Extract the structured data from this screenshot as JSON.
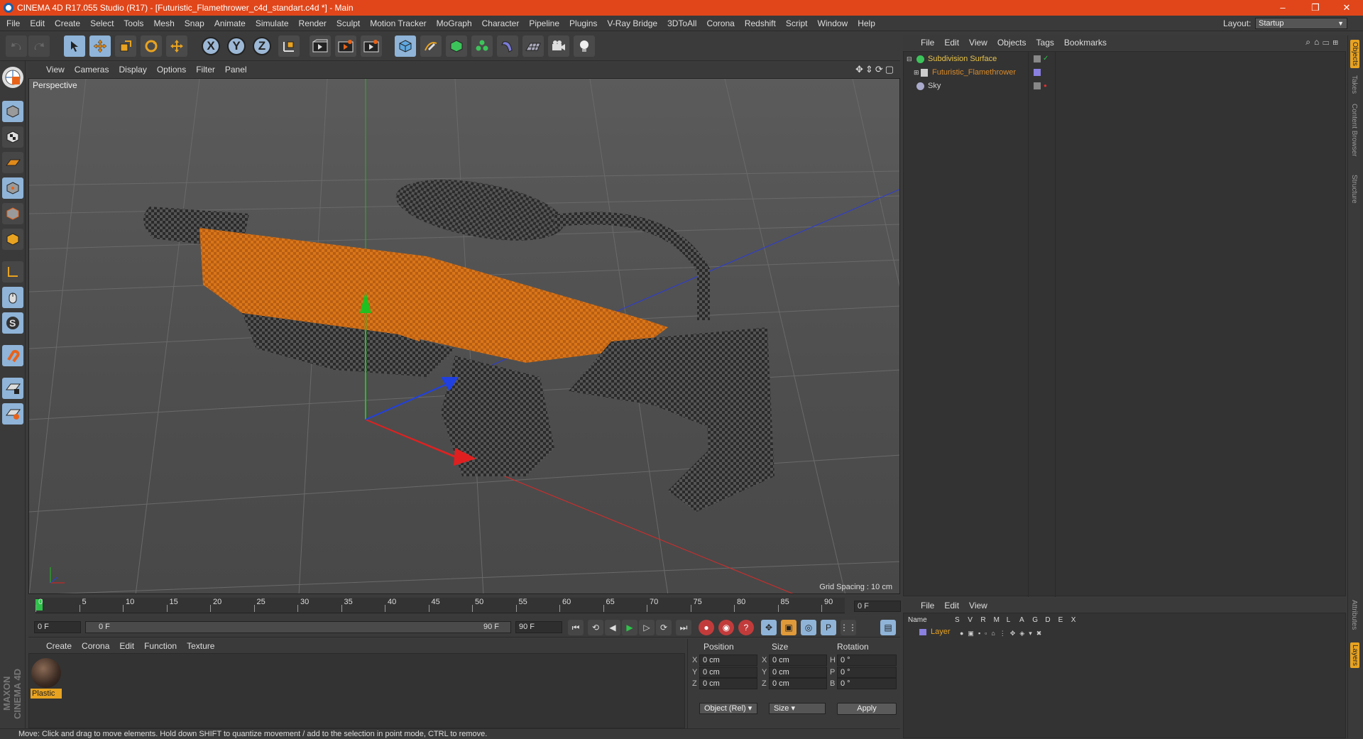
{
  "window": {
    "title": "CINEMA 4D R17.055 Studio (R17) - [Futuristic_Flamethrower_c4d_standart.c4d *] - Main",
    "minimize": "–",
    "restore": "❐",
    "close": "✕"
  },
  "menubar": {
    "items": [
      "File",
      "Edit",
      "Create",
      "Select",
      "Tools",
      "Mesh",
      "Snap",
      "Animate",
      "Simulate",
      "Render",
      "Sculpt",
      "Motion Tracker",
      "MoGraph",
      "Character",
      "Pipeline",
      "Plugins",
      "V-Ray Bridge",
      "3DToAll",
      "Corona",
      "Redshift",
      "Script",
      "Window",
      "Help"
    ],
    "layout_label": "Layout:",
    "layout_value": "Startup"
  },
  "toolbar": {
    "icons": [
      "undo-icon",
      "redo-icon",
      "live-selection-icon",
      "move-icon",
      "scale-icon",
      "rotate-icon",
      "last-tool-icon",
      "x-axis-icon",
      "y-axis-icon",
      "z-axis-icon",
      "world-coord-icon",
      "render-view-icon",
      "render-picture-viewer-icon",
      "edit-render-settings-icon",
      "cube-icon",
      "pen-spline-icon",
      "subdivision-icon",
      "cloner-icon",
      "deformer-icon",
      "floor-icon",
      "camera-icon",
      "light-icon"
    ],
    "axis_labels": [
      "X",
      "Y",
      "Z"
    ]
  },
  "viewport": {
    "menu": [
      "View",
      "Cameras",
      "Display",
      "Options",
      "Filter",
      "Panel"
    ],
    "label": "Perspective",
    "grid_spacing": "Grid Spacing : 10 cm",
    "axis_colors": {
      "x": "#e02020",
      "y": "#20c020",
      "z": "#2040e0"
    }
  },
  "timeline": {
    "ticks": [
      "0",
      "5",
      "10",
      "15",
      "20",
      "25",
      "30",
      "35",
      "40",
      "45",
      "50",
      "55",
      "60",
      "65",
      "70",
      "75",
      "80",
      "85",
      "90"
    ],
    "current_frame": "0 F",
    "end_field": "0 F"
  },
  "playbar": {
    "start_field": "0 F",
    "range_start": "0 F",
    "range_end": "90 F",
    "end_field": "90 F"
  },
  "material_manager": {
    "menu": [
      "Create",
      "Corona",
      "Edit",
      "Function",
      "Texture"
    ],
    "material_name": "Plastic"
  },
  "coordinates": {
    "headers": {
      "position": "Position",
      "size": "Size",
      "rotation": "Rotation"
    },
    "rows": [
      {
        "pos_axis": "X",
        "pos": "0 cm",
        "size_axis": "X",
        "size": "0 cm",
        "rot_axis": "H",
        "rot": "0 °"
      },
      {
        "pos_axis": "Y",
        "pos": "0 cm",
        "size_axis": "Y",
        "size": "0 cm",
        "rot_axis": "P",
        "rot": "0 °"
      },
      {
        "pos_axis": "Z",
        "pos": "0 cm",
        "size_axis": "Z",
        "size": "0 cm",
        "rot_axis": "B",
        "rot": "0 °"
      }
    ],
    "mode_dropdown": "Object (Rel)",
    "size_dropdown": "Size",
    "apply": "Apply"
  },
  "status": "Move: Click and drag to move elements. Hold down SHIFT to quantize movement / add to the selection in point mode, CTRL to remove.",
  "maxon_logo": "MAXON CINEMA 4D",
  "object_manager": {
    "menu": [
      "File",
      "Edit",
      "View",
      "Objects",
      "Tags",
      "Bookmarks"
    ],
    "objects": [
      {
        "name": "Subdivision Surface",
        "color": "#e8c34a"
      },
      {
        "name": "Futuristic_Flamethrower",
        "color": "#d98a2a"
      },
      {
        "name": "Sky",
        "color": "#cfcfcf"
      }
    ]
  },
  "side_tabs": [
    "Objects",
    "Takes",
    "Content Browser",
    "Structure"
  ],
  "side_tabs_bottom": [
    "Attributes",
    "Layers"
  ],
  "layer_manager": {
    "menu": [
      "File",
      "Edit",
      "View"
    ],
    "columns": [
      "Name",
      "S",
      "V",
      "R",
      "M",
      "L",
      "A",
      "G",
      "D",
      "E",
      "X"
    ],
    "layer_name": "Layer",
    "layer_color": "#e8a321"
  }
}
